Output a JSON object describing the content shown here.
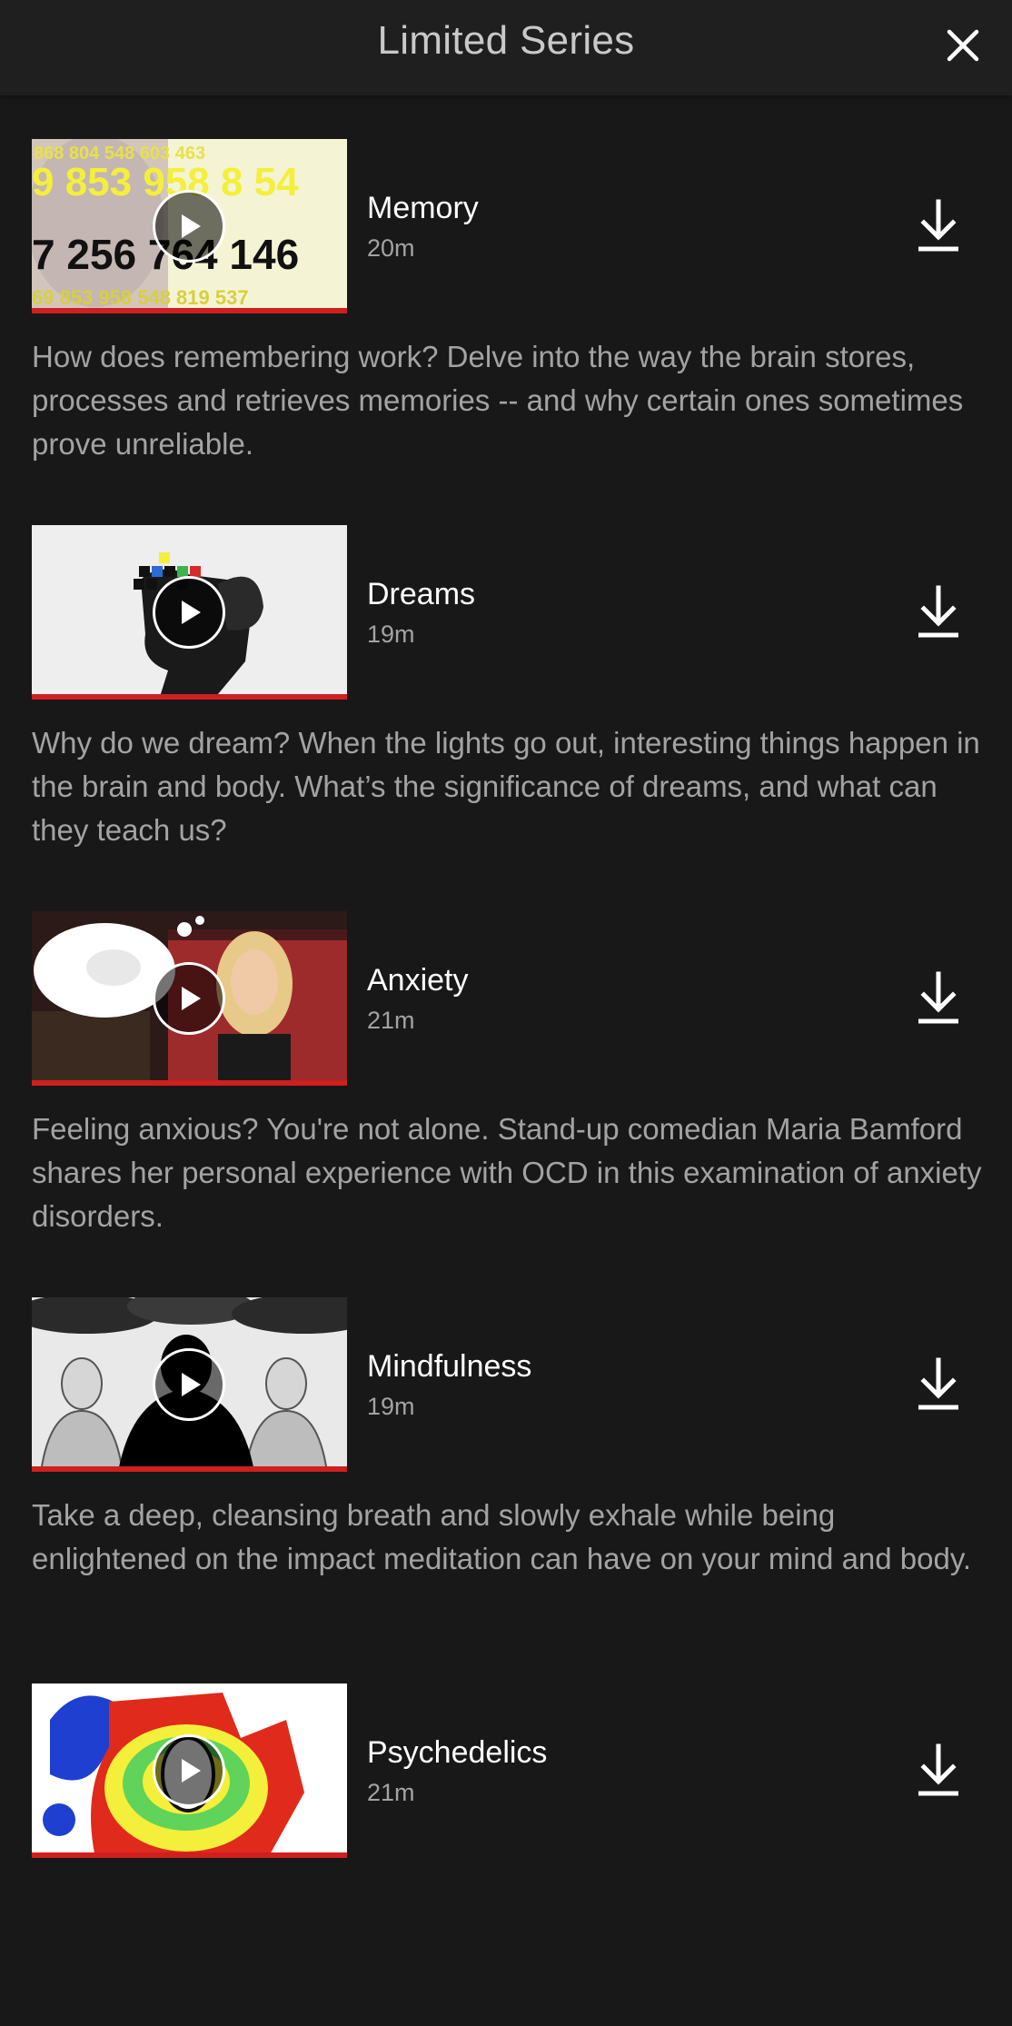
{
  "header": {
    "title": "Limited Series",
    "close_icon": "close-icon"
  },
  "colors": {
    "background": "#181818",
    "header_bg": "#1f1f1f",
    "progress": "#d01f1f",
    "muted_text": "#a3a3a3"
  },
  "episodes": [
    {
      "title": "Memory",
      "duration": "20m",
      "description": "How does remembering work? Delve into the way the brain stores, processes and retrieves memories -- and why certain ones sometimes prove unreliable.",
      "watched_fraction": 1.0,
      "thumb_numbers": [
        "868 804 548 603 463",
        "9 853 958 8 54",
        "7 256 764 146",
        "69 853 958 548 819 537"
      ]
    },
    {
      "title": "Dreams",
      "duration": "19m",
      "description": "Why do we dream? When the lights go out, interesting things happen in the brain and body. What’s the significance of dreams, and what can they teach us?",
      "watched_fraction": 1.0
    },
    {
      "title": "Anxiety",
      "duration": "21m",
      "description": "Feeling anxious? You're not alone. Stand-up comedian Maria Bamford shares her personal experience with OCD in this examination of anxiety disorders.",
      "watched_fraction": 1.0
    },
    {
      "title": "Mindfulness",
      "duration": "19m",
      "description": "Take a deep, cleansing breath and slowly exhale while being enlightened on the impact meditation can have on your mind and body.",
      "watched_fraction": 1.0
    },
    {
      "title": "Psychedelics",
      "duration": "21m",
      "description": "",
      "watched_fraction": 1.0
    }
  ],
  "icons": {
    "play": "play-icon",
    "download": "download-icon"
  }
}
